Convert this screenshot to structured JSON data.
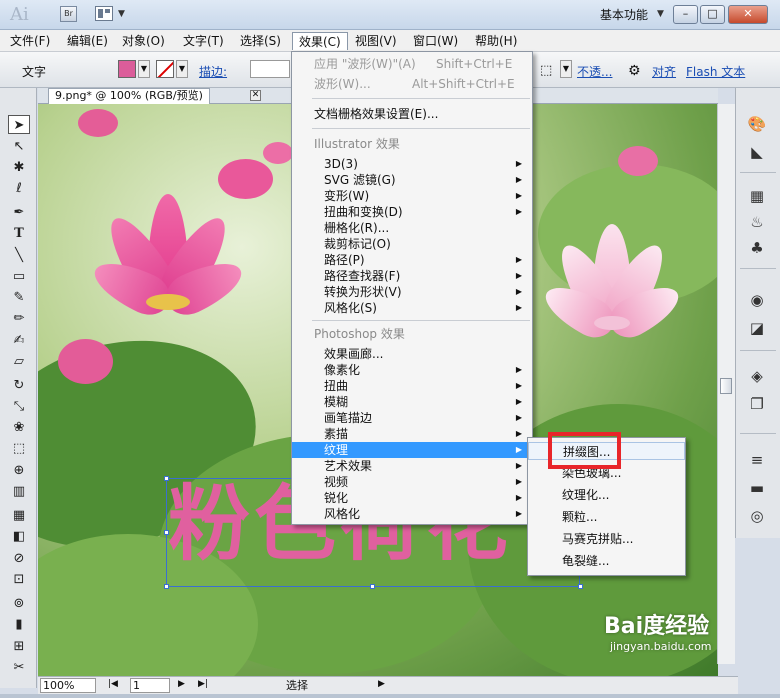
{
  "titlebar": {
    "app_logo": "Ai",
    "bridge_label": "Br",
    "workspace": "基本功能",
    "minimize": "–",
    "maximize": "□",
    "close": "✕"
  },
  "menubar": {
    "items": [
      "文件(F)",
      "编辑(E)",
      "对象(O)",
      "文字(T)",
      "选择(S)",
      "效果(C)",
      "视图(V)",
      "窗口(W)",
      "帮助(H)"
    ]
  },
  "controlbar": {
    "type_label": "文字",
    "stroke_label": "描边:",
    "opacity_link": "不透...",
    "align_link": "对齐",
    "flash_link": "Flash 文本",
    "fill_color": "#db5d9a"
  },
  "document": {
    "tab_label": "9.png* @ 100% (RGB/预览)",
    "text_content": "粉色荷花"
  },
  "statusbar": {
    "zoom": "100%",
    "page": "1",
    "status": "选择"
  },
  "effect_menu": {
    "apply_last": "应用 \"波形(W)\"(A)",
    "apply_last_shortcut": "Shift+Ctrl+E",
    "last_effect": "波形(W)...",
    "last_effect_shortcut": "Alt+Shift+Ctrl+E",
    "document_raster": "文档栅格效果设置(E)...",
    "illustrator_header": "Illustrator 效果",
    "illustrator_items": [
      "3D(3)",
      "SVG 滤镜(G)",
      "变形(W)",
      "扭曲和变换(D)",
      "栅格化(R)...",
      "裁剪标记(O)",
      "路径(P)",
      "路径查找器(F)",
      "转换为形状(V)",
      "风格化(S)"
    ],
    "photoshop_header": "Photoshop 效果",
    "photoshop_items": [
      "效果画廊...",
      "像素化",
      "扭曲",
      "模糊",
      "画笔描边",
      "素描",
      "纹理",
      "艺术效果",
      "视频",
      "锐化",
      "风格化"
    ]
  },
  "texture_submenu": {
    "items": [
      "拼缀图...",
      "染色玻璃...",
      "纹理化...",
      "颗粒...",
      "马赛克拼贴...",
      "龟裂缝..."
    ]
  },
  "watermark": {
    "logo": "Bai度经验",
    "url": "jingyan.baidu.com"
  }
}
